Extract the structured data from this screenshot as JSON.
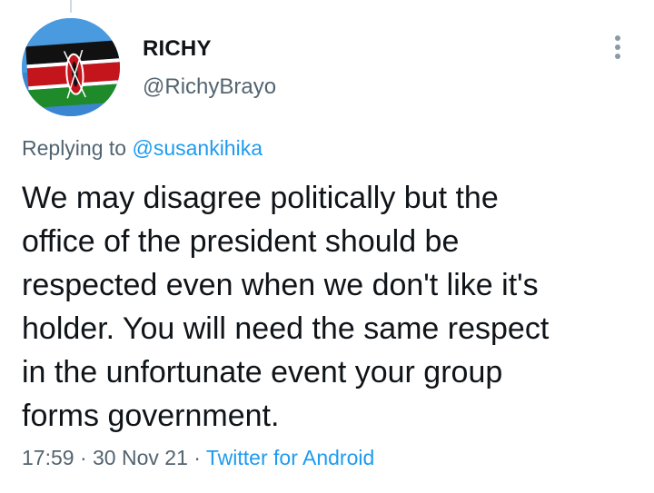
{
  "author": {
    "name": "RICHY",
    "handle": "@RichyBrayo",
    "avatar_icon": "kenya-flag-icon"
  },
  "reply": {
    "prefix": "Replying to ",
    "mention": "@susankihika"
  },
  "tweet": {
    "lines": [
      "We may disagree politically but the",
      "office of the president should be",
      "respected even when we don't like it's",
      "holder. You will need the same respect",
      "in the unfortunate event your group",
      "forms government."
    ]
  },
  "meta": {
    "time": "17:59",
    "sep1": " · ",
    "date": "30 Nov 21",
    "sep2": " · ",
    "source": "Twitter for Android"
  },
  "colors": {
    "text": "#0f1419",
    "secondary": "#536471",
    "accent": "#1d9bf0",
    "flag_black": "#000000",
    "flag_red": "#bb0000",
    "flag_green": "#006600"
  }
}
